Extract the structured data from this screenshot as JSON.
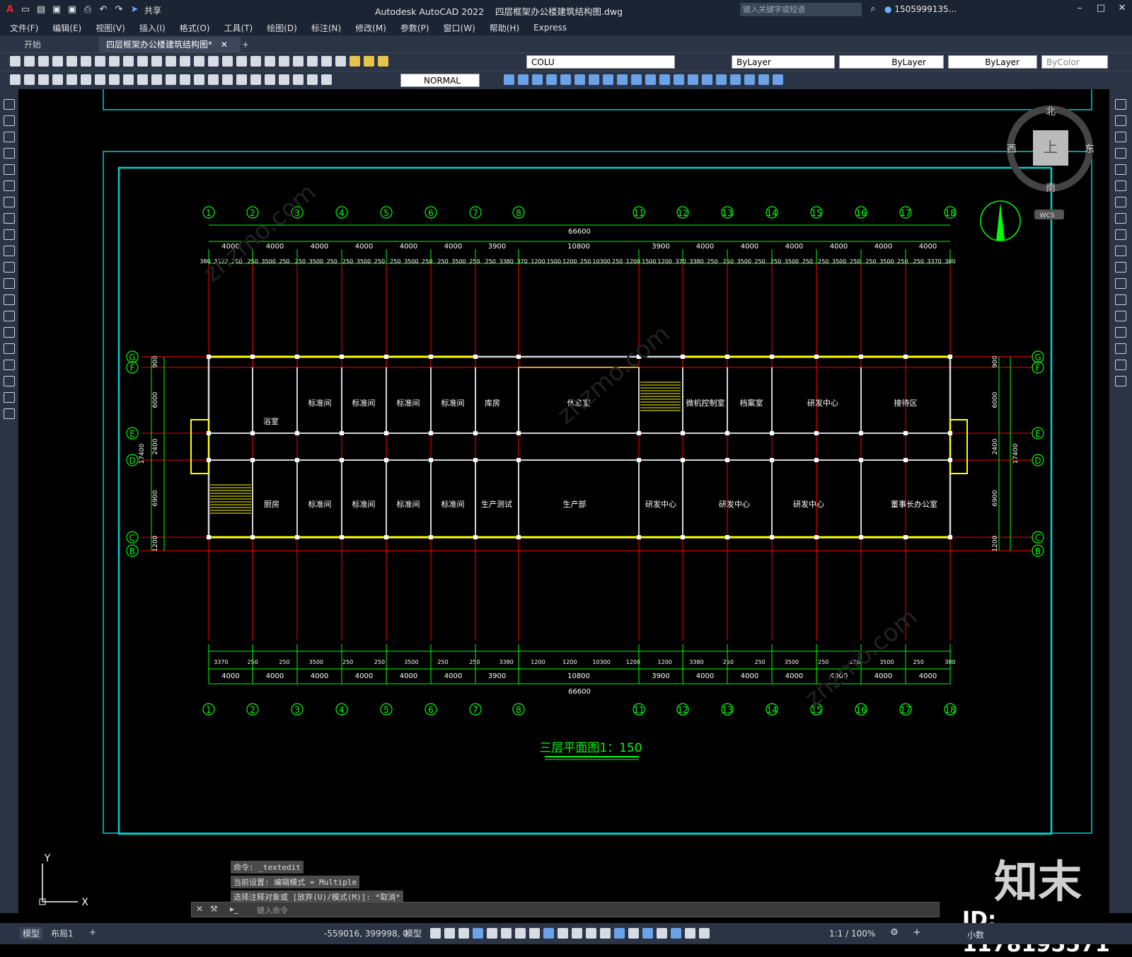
{
  "titlebar": {
    "app_name": "Autodesk AutoCAD 2022",
    "file_name": "四层框架办公楼建筑结构图.dwg",
    "share_label": "共享",
    "search_placeholder": "键入关键字或短语",
    "user": "1505999135..."
  },
  "menubar": [
    "文件(F)",
    "编辑(E)",
    "视图(V)",
    "插入(I)",
    "格式(O)",
    "工具(T)",
    "绘图(D)",
    "标注(N)",
    "修改(M)",
    "参数(P)",
    "窗口(W)",
    "帮助(H)",
    "Express"
  ],
  "tabs": {
    "start": "开始",
    "doc": "四层框架办公楼建筑结构图*"
  },
  "properties": {
    "layer": "COLU",
    "color": "ByLayer",
    "linetype": "ByLayer",
    "lineweight": "ByLayer",
    "plotstyle": "ByColor",
    "dimstyle": "NORMAL"
  },
  "viewcube": {
    "north": "北",
    "south": "南",
    "west": "西",
    "east": "东",
    "top": "上",
    "wcs": "WCS"
  },
  "drawing": {
    "title": "三层平面图1：150",
    "axes_top": [
      "1",
      "2",
      "3",
      "4",
      "5",
      "6",
      "7",
      "8",
      "11",
      "12",
      "13",
      "14",
      "15",
      "16",
      "17",
      "18"
    ],
    "rows": [
      "G",
      "F",
      "E",
      "D",
      "C",
      "B"
    ],
    "dims_top_bays": [
      "4000",
      "4000",
      "4000",
      "4000",
      "4000",
      "4000",
      "3900",
      "10800",
      "3900",
      "4000",
      "4000",
      "4000",
      "4000",
      "4000",
      "4000"
    ],
    "dim_total": "66600",
    "dims_detail_top": [
      "380",
      "3370",
      "250",
      "250",
      "3500",
      "250",
      "250",
      "3500",
      "250",
      "250",
      "3500",
      "250",
      "250",
      "3500",
      "250",
      "250",
      "3500",
      "250",
      "250",
      "3380",
      "370",
      "1200",
      "1500",
      "1200",
      "250",
      "10300",
      "250",
      "1200",
      "1500",
      "1200",
      "370",
      "3380",
      "250",
      "250",
      "3500",
      "250",
      "250",
      "3500",
      "250",
      "250",
      "3500",
      "250",
      "250",
      "3500",
      "250",
      "250",
      "3370",
      "380"
    ],
    "dims_left": [
      "900",
      "6000",
      "2400",
      "6900",
      "1200",
      "17400"
    ],
    "rooms_upper": [
      "浴室",
      "标准间",
      "标准间",
      "标准间",
      "标准间",
      "库房",
      "休息室",
      "微机控制室",
      "档案室",
      "研发中心",
      "接待区"
    ],
    "rooms_lower": [
      "厨房",
      "标准间",
      "标准间",
      "标准间",
      "标准间",
      "生产测试",
      "生产部",
      "研发中心",
      "研发中心",
      "研发中心",
      "董事长办公室"
    ]
  },
  "command": {
    "history": [
      "命令: _textedit",
      "当前设置: 编辑模式 = Multiple",
      "选择注释对象或 [放弃(U)/模式(M)]: *取消*"
    ],
    "placeholder": "键入命令"
  },
  "statusbar": {
    "model": "模型",
    "layout": "布局1",
    "coords": "-559016, 399998, 0",
    "model_btn": "模型",
    "scale": "1:1 / 100%",
    "units": "小数"
  },
  "ucs": {
    "x": "X",
    "y": "Y"
  },
  "watermark": {
    "logo": "知末",
    "id": "ID: 1178195571",
    "site": "znzmo.com"
  },
  "colors": {
    "dims": "#00ff00",
    "grid": "#ff0000",
    "walls": "#d4d4d4",
    "windows": "#ffff00",
    "frame": "#00d0d0",
    "bg": "#000000"
  }
}
